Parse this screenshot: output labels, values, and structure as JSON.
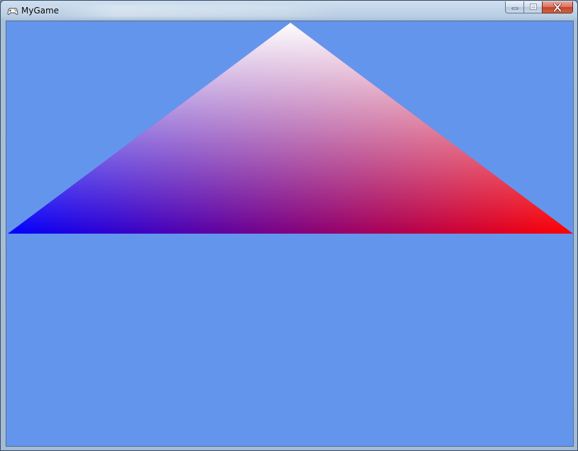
{
  "window": {
    "title": "MyGame",
    "app_icon": "gamepad-icon",
    "controls": {
      "minimize_icon": "minimize-icon",
      "maximize_icon": "maximize-icon",
      "close_icon": "close-icon"
    }
  },
  "scene": {
    "clear_color": "#6495ED",
    "triangle": {
      "vertex_colors": {
        "top": "#FFFFFF",
        "left": "#0000FF",
        "right": "#FF0000"
      }
    }
  }
}
